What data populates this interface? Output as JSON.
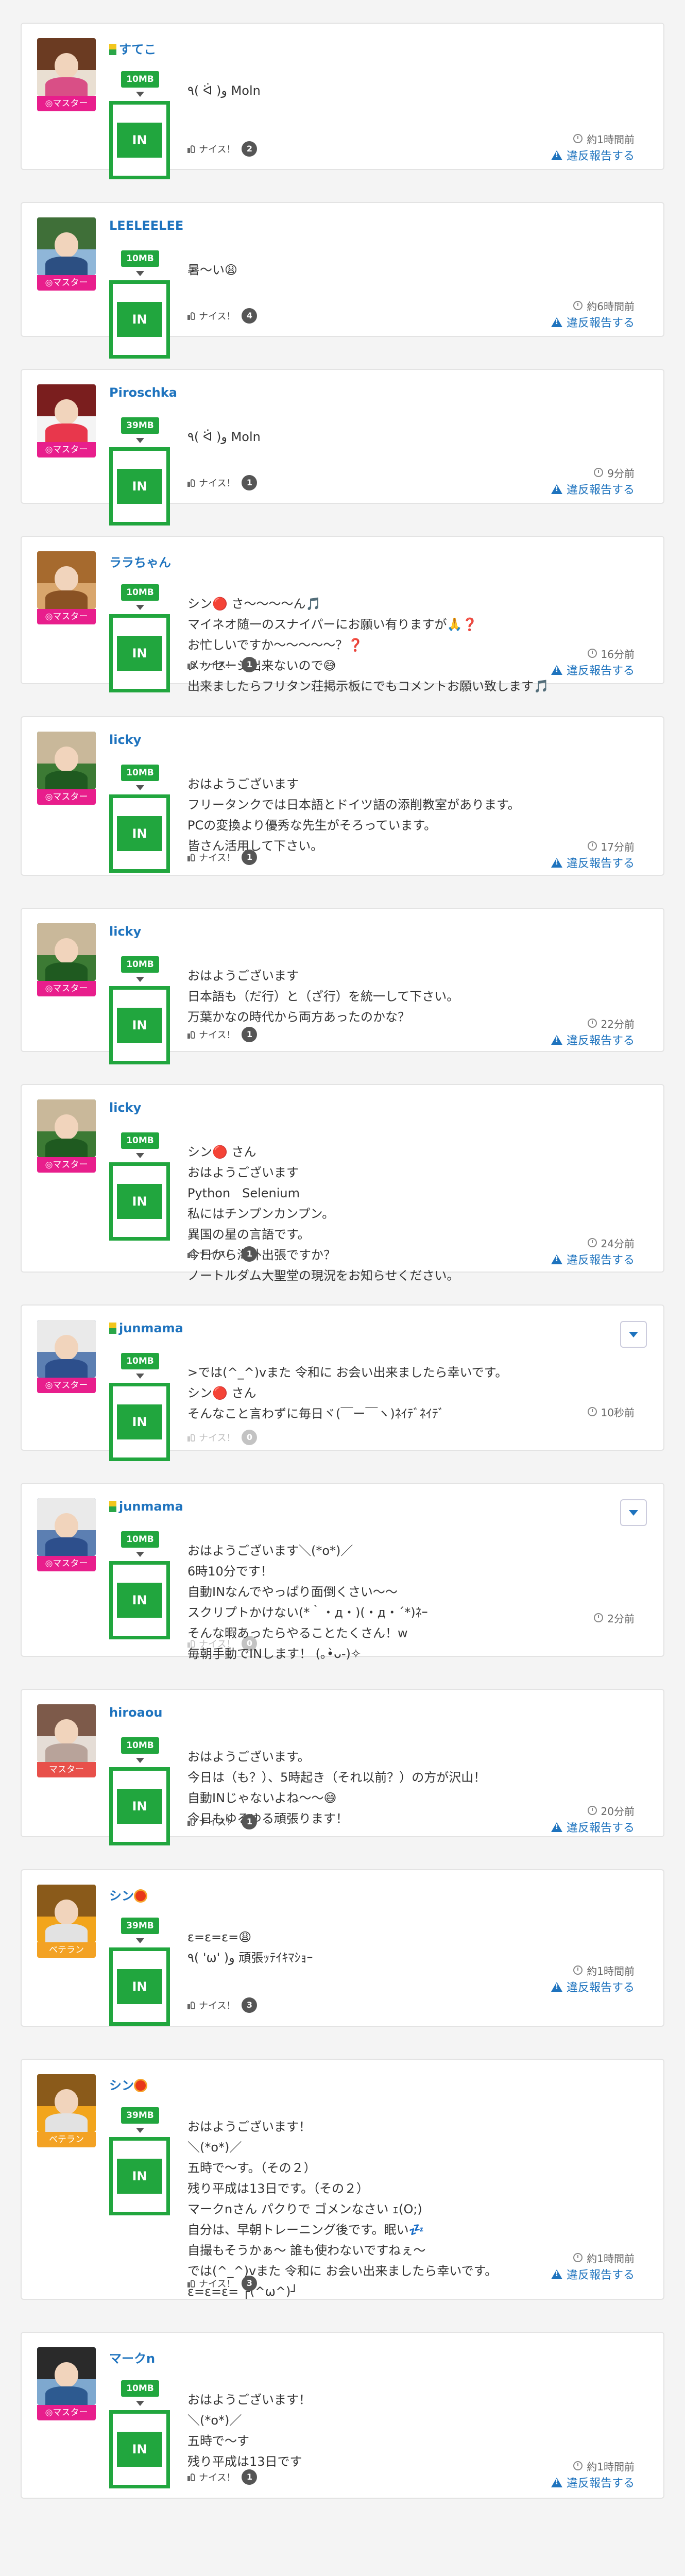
{
  "labels": {
    "nice": "ナイス！",
    "report": "違反報告する",
    "in": "IN"
  },
  "colors": {
    "link": "#1e73be",
    "in_green": "#21a63e",
    "master_tag": "#e81e8c",
    "veteran_tag": "#f3a224"
  },
  "posts": [
    {
      "user": "すてこ",
      "role": "◎マスター",
      "role_type": "master",
      "beginner": true,
      "sun": false,
      "size": "10MB",
      "message": [
        "٩( ᐛ )و Moln"
      ],
      "nice": "2",
      "time": "約1時間前",
      "dropdown": false
    },
    {
      "user": "LEELEELEE",
      "role": "◎マスター",
      "role_type": "master",
      "beginner": false,
      "sun": false,
      "size": "10MB",
      "message": [
        "暑〜い😩"
      ],
      "nice": "4",
      "time": "約6時間前",
      "dropdown": false
    },
    {
      "user": "Piroschka",
      "role": "◎マスター",
      "role_type": "master",
      "beginner": false,
      "sun": false,
      "size": "39MB",
      "message": [
        "٩( ᐛ )و Moln"
      ],
      "nice": "1",
      "time": "9分前",
      "dropdown": false
    },
    {
      "user": "ララちゃん",
      "role": "◎マスター",
      "role_type": "master",
      "beginner": false,
      "sun": false,
      "size": "10MB",
      "message": [
        "シン🔴 さ〜〜〜〜ん🎵",
        "マイネオ随一のスナイパーにお願い有りますが🙏❓",
        "お忙しいですか〜〜〜〜〜？❓",
        "メッセージ出来ないので😅",
        "出来ましたらフリタン荘掲示板にでもコメントお願い致します🎵"
      ],
      "nice": "1",
      "time": "16分前",
      "dropdown": false
    },
    {
      "user": "licky",
      "role": "◎マスター",
      "role_type": "master",
      "beginner": false,
      "sun": false,
      "size": "10MB",
      "message": [
        "おはようございます",
        "フリータンクでは日本語とドイツ語の添削教室があります。",
        "PCの変換より優秀な先生がそろっています。",
        "皆さん活用して下さい。"
      ],
      "nice": "1",
      "time": "17分前",
      "dropdown": false
    },
    {
      "user": "licky",
      "role": "◎マスター",
      "role_type": "master",
      "beginner": false,
      "sun": false,
      "size": "10MB",
      "message": [
        "おはようございます",
        "日本語も（だ行）と（ざ行）を統一して下さい。",
        "万葉かなの時代から両方あったのかな？"
      ],
      "nice": "1",
      "time": "22分前",
      "dropdown": false
    },
    {
      "user": "licky",
      "role": "◎マスター",
      "role_type": "master",
      "beginner": false,
      "sun": false,
      "size": "10MB",
      "message": [
        "シン🔴 さん",
        "おはようございます",
        "Python   Selenium",
        "私にはチンプンカンプン。",
        "異国の星の言語です。",
        "今日から海外出張ですか？",
        "ノートルダム大聖堂の現況をお知らせください。"
      ],
      "nice": "1",
      "time": "24分前",
      "dropdown": false
    },
    {
      "user": "junmama",
      "role": "◎マスター",
      "role_type": "master",
      "beginner": true,
      "sun": false,
      "size": "10MB",
      "message": [
        ">では(^_^)vまた 令和に お会い出来ましたら幸いです。",
        "シン🔴 さん",
        "そんなこと言わずに毎日ヾ(￣ー￣ヽ)ﾈｲﾃﾞﾈｲﾃﾞ"
      ],
      "nice": "0",
      "time": "10秒前",
      "dropdown": true
    },
    {
      "user": "junmama",
      "role": "◎マスター",
      "role_type": "master",
      "beginner": true,
      "sun": false,
      "size": "10MB",
      "message": [
        "おはようございます＼(*o*)／",
        "6時10分です！",
        "自動INなんでやっぱり面倒くさい〜〜",
        "スクリプトかけない(*｀・д・)(・д・´*)ﾈｰ",
        "そんな暇あったらやることたくさん！w",
        "毎朝手動でINします！ (｡•̀ᴗ-)✧"
      ],
      "nice": "0",
      "time": "2分前",
      "dropdown": true
    },
    {
      "user": "hiroaou",
      "role": "マスター",
      "role_type": "veteran-red",
      "beginner": false,
      "sun": false,
      "size": "10MB",
      "message": [
        "おはようございます。",
        "今日は（も？）、5時起き（それ以前？）の方が沢山！",
        "自動INじゃないよね〜〜😅",
        "今日もゆるゆる頑張ります！"
      ],
      "nice": "1",
      "time": "20分前",
      "dropdown": false
    },
    {
      "user": "シン",
      "role": "ベテラン",
      "role_type": "veteran",
      "beginner": false,
      "sun": true,
      "size": "39MB",
      "message": [
        "ε=ε=ε=😩",
        "٩( 'ω' )و 頑張ｯﾃｲｷﾏｼｮｰ"
      ],
      "nice": "3",
      "time": "約1時間前",
      "dropdown": false
    },
    {
      "user": "シン",
      "role": "ベテラン",
      "role_type": "veteran",
      "beginner": false,
      "sun": true,
      "size": "39MB",
      "message": [
        "おはようございます！",
        "＼(*o*)／",
        "五時で〜す。（その２）",
        "残り平成は13日です。（その２）",
        "マークnさん パクりで ゴメンなさい ｪ(O;)",
        "自分は、早朝トレーニング後です。眠い💤",
        "自撮もそうかぁ〜 誰も使わないですねぇ〜",
        "では(^_^)vまた 令和に お会い出来ましたら幸いです。",
        "ε=ε=ε= ┌(^ω^)┘"
      ],
      "nice": "3",
      "time": "約1時間前",
      "dropdown": false
    },
    {
      "user": "マークn",
      "role": "◎マスター",
      "role_type": "master",
      "beginner": false,
      "sun": false,
      "size": "10MB",
      "message": [
        "おはようございます！",
        "＼(*o*)／",
        "五時で〜す",
        "残り平成は13日です"
      ],
      "nice": "1",
      "time": "約1時間前",
      "dropdown": false
    }
  ]
}
